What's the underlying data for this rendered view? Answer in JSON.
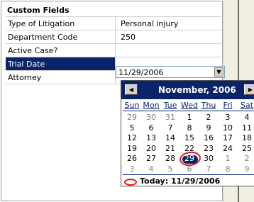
{
  "panel": {
    "title": "Custom Fields",
    "rows": [
      {
        "label": "Type of Litigation",
        "value": "Personal injury"
      },
      {
        "label": "Department Code",
        "value": "250"
      },
      {
        "label": "Active Case?",
        "value": ""
      },
      {
        "label": "Trial Date",
        "value": ""
      },
      {
        "label": "Attorney",
        "value": ""
      }
    ]
  },
  "date_combo": {
    "value": "11/29/2006",
    "dropdown_icon": "chevron-down-icon"
  },
  "calendar": {
    "month_label": "November, 2006",
    "prev_icon": "triangle-left-icon",
    "next_icon": "triangle-right-icon",
    "weekdays": [
      "Sun",
      "Mon",
      "Tue",
      "Wed",
      "Thu",
      "Fri",
      "Sat"
    ],
    "weeks": [
      [
        "29",
        "30",
        "31",
        "1",
        "2",
        "3",
        "4"
      ],
      [
        "5",
        "6",
        "7",
        "8",
        "9",
        "10",
        "11"
      ],
      [
        "12",
        "13",
        "14",
        "15",
        "16",
        "17",
        "18"
      ],
      [
        "19",
        "20",
        "21",
        "22",
        "23",
        "24",
        "25"
      ],
      [
        "26",
        "27",
        "28",
        "29",
        "30",
        "1",
        "2"
      ],
      [
        "3",
        "4",
        "5",
        "6",
        "7",
        "8",
        "9"
      ]
    ],
    "selected_day": "29",
    "today_text": "Today: 11/29/2006",
    "colors": {
      "header": "#0a246a",
      "highlight": "#e21a1a",
      "other_month": "#808080"
    }
  }
}
